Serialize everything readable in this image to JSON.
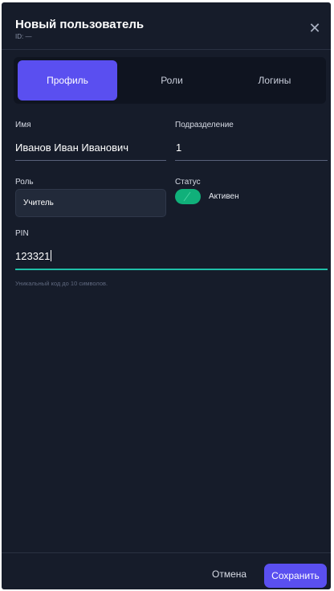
{
  "dialog": {
    "title": "Новый пользователь",
    "subtitle": "ID: —",
    "close_icon": "close-icon",
    "close_glyph": "✕"
  },
  "tabs": [
    {
      "label": "Профиль",
      "active": true
    },
    {
      "label": "Роли",
      "active": false
    },
    {
      "label": "Логины",
      "active": false
    }
  ],
  "form": {
    "name": {
      "label": "Имя",
      "value": "Иванов Иван Иванович"
    },
    "department": {
      "label": "Подразделение",
      "value": "1"
    },
    "role": {
      "label": "Роль",
      "value": "Учитель"
    },
    "status": {
      "label": "Статус",
      "value": "Активен",
      "enabled": true
    },
    "pin": {
      "label": "PIN",
      "value": "123321",
      "hint": "Уникальный код до 10 символов."
    }
  },
  "footer": {
    "cancel_label": "Отмена",
    "save_label": "Сохранить"
  },
  "colors": {
    "accent": "#5a4ff0",
    "toggle_on": "#10b07a",
    "focus_underline": "#1fbfa8",
    "background": "#161c2a"
  }
}
